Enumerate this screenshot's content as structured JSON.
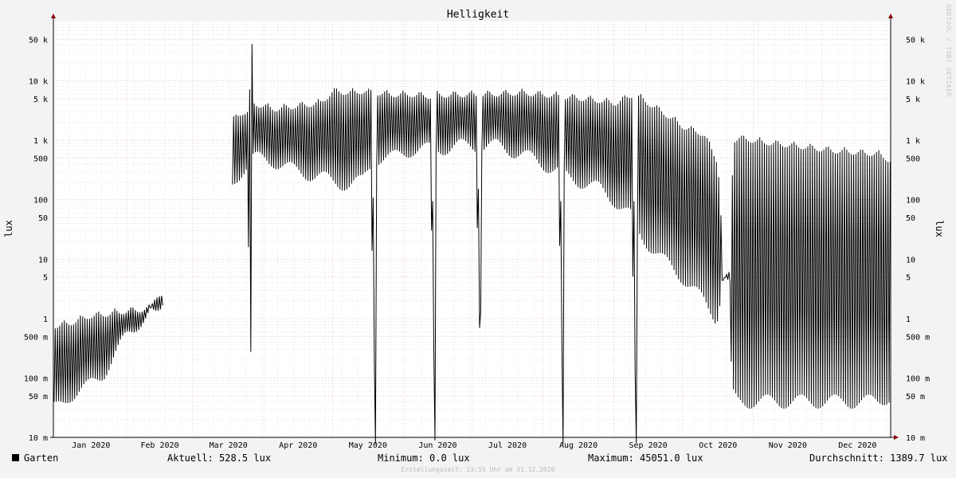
{
  "chart_data": {
    "type": "line",
    "title": "Helligkeit",
    "ylabel": "lux",
    "yscale": "log",
    "ylim": [
      0.01,
      100000
    ],
    "ytick_values": [
      0.01,
      0.05,
      0.1,
      0.5,
      1,
      5,
      10,
      50,
      100,
      500,
      1000,
      5000,
      10000,
      50000
    ],
    "ytick_labels": [
      "10 m",
      "50 m",
      "100 m",
      "500 m",
      "1",
      "5",
      "10",
      "50",
      "100",
      "500",
      "1 k",
      "5 k",
      "10 k",
      "50 k"
    ],
    "xlim": [
      "2019-12-31",
      "2020-12-31"
    ],
    "xtick_labels": [
      "Jan 2020",
      "Feb 2020",
      "Mar 2020",
      "Apr 2020",
      "May 2020",
      "Jun 2020",
      "Jul 2020",
      "Aug 2020",
      "Sep 2020",
      "Oct 2020",
      "Nov 2020",
      "Dec 2020"
    ],
    "grid": true,
    "series": [
      {
        "name": "Garten",
        "color": "#000000",
        "x": [
          "2020-01-01",
          "2020-01-07",
          "2020-01-15",
          "2020-01-22",
          "2020-02-01",
          "2020-02-08",
          "2020-02-16",
          "2020-03-19",
          "2020-03-22",
          "2020-03-25",
          "2020-03-26",
          "2020-03-27",
          "2020-04-05",
          "2020-04-15",
          "2020-04-25",
          "2020-05-01",
          "2020-05-08",
          "2020-05-14",
          "2020-05-18",
          "2020-05-19",
          "2020-05-20",
          "2020-05-27",
          "2020-06-05",
          "2020-06-13",
          "2020-06-14",
          "2020-06-15",
          "2020-06-25",
          "2020-07-03",
          "2020-07-04",
          "2020-07-05",
          "2020-07-12",
          "2020-07-22",
          "2020-08-01",
          "2020-08-08",
          "2020-08-09",
          "2020-08-10",
          "2020-08-18",
          "2020-08-26",
          "2020-09-01",
          "2020-09-09",
          "2020-09-10",
          "2020-09-11",
          "2020-09-22",
          "2020-10-01",
          "2020-10-10",
          "2020-10-16",
          "2020-10-19",
          "2020-10-20",
          "2020-10-23",
          "2020-10-25",
          "2020-11-05",
          "2020-11-15",
          "2020-11-25",
          "2020-12-05",
          "2020-12-15",
          "2020-12-25",
          "2020-12-31"
        ],
        "y_day": [
          0.9,
          1.0,
          1.3,
          1.4,
          1.6,
          1.7,
          1.8,
          3000,
          3500,
          3500,
          45051,
          5000,
          4000,
          4500,
          5000,
          8000,
          7500,
          8000,
          7500,
          0.0,
          7500,
          7000,
          7000,
          6500,
          0.0,
          6800,
          7000,
          7000,
          0.05,
          7000,
          7200,
          7500,
          7000,
          6500,
          0.0,
          6500,
          6000,
          5500,
          5000,
          7000,
          0.0,
          6500,
          3500,
          2000,
          1500,
          500,
          5,
          5,
          1200,
          1300,
          1100,
          1000,
          900,
          800,
          750,
          700,
          528.5
        ],
        "y_night": [
          0.03,
          0.05,
          0.07,
          0.12,
          0.5,
          1.0,
          2.0,
          200,
          300,
          400,
          0.0,
          500,
          450,
          300,
          250,
          200,
          180,
          200,
          400,
          0.0,
          500,
          500,
          700,
          700,
          0.0,
          700,
          800,
          800,
          0.05,
          800,
          800,
          600,
          400,
          300,
          0.0,
          250,
          200,
          150,
          100,
          50,
          0.0,
          30,
          10,
          5,
          2,
          1,
          5,
          5,
          0.05,
          0.04,
          0.04,
          0.04,
          0.04,
          0.04,
          0.04,
          0.04,
          0.05
        ]
      }
    ]
  },
  "legend": {
    "series_name": "Garten",
    "current": "Aktuell: 528.5 lux",
    "minimum": "Minimum:   0.0 lux",
    "maximum": "Maximum: 45051.0 lux",
    "average": "Durchschnitt: 1389.7 lux"
  },
  "footer": "Erstellungszeit: 23:55 Uhr am 31.12.2020",
  "watermark": "RRDTOOL / TOBI OETIKER",
  "colors": {
    "background": "#f3f3f3",
    "plot": "#ffffff",
    "grid_minor": "#d8d8d8",
    "grid_major": "#e6b8c0",
    "line": "#000000",
    "arrow": "#8b0000"
  }
}
